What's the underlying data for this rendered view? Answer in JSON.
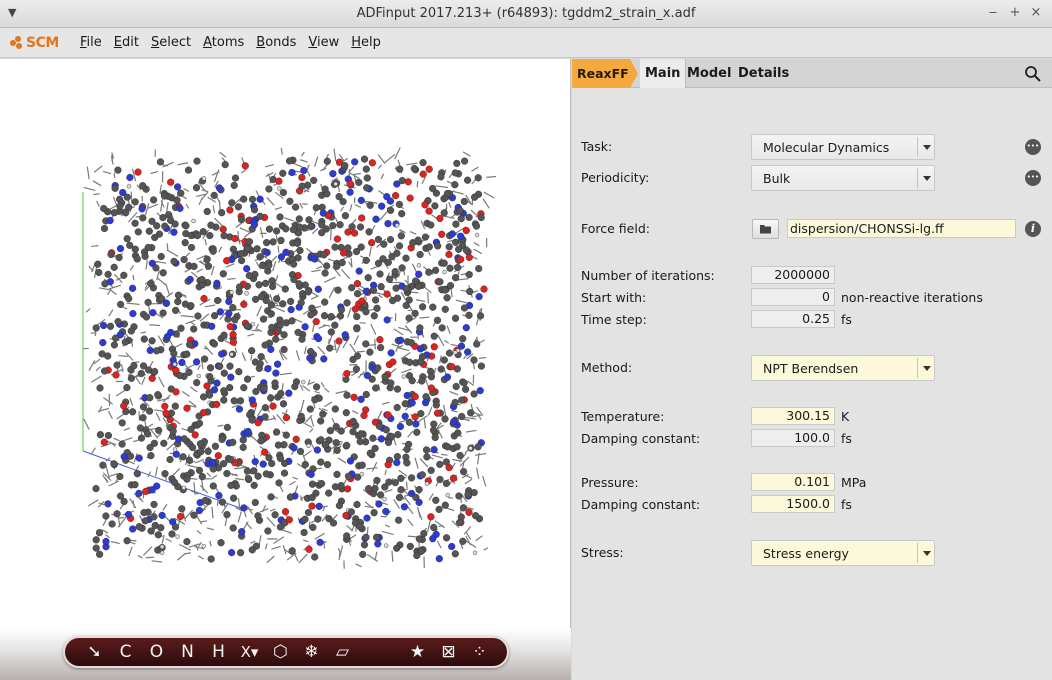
{
  "window": {
    "title": "ADFinput 2017.213+ (r64893): tgddm2_strain_x.adf",
    "menu_glyph": "▼",
    "min_glyph": "‒",
    "max_glyph": "+",
    "close_glyph": "×"
  },
  "logo": {
    "text": "SCM",
    "color": "#e2761a"
  },
  "menu": [
    "File",
    "Edit",
    "Select",
    "Atoms",
    "Bonds",
    "View",
    "Help"
  ],
  "toolbar": {
    "tools": [
      {
        "name": "select-arrow-tool",
        "glyph": "➘"
      },
      {
        "name": "carbon-tool",
        "glyph": "C"
      },
      {
        "name": "oxygen-tool",
        "glyph": "O"
      },
      {
        "name": "nitrogen-tool",
        "glyph": "N"
      },
      {
        "name": "hydrogen-tool",
        "glyph": "H"
      },
      {
        "name": "other-element-tool",
        "glyph": "X▾"
      },
      {
        "name": "ring-tool",
        "glyph": "⬡"
      },
      {
        "name": "structure-tool",
        "glyph": "❄"
      },
      {
        "name": "slab-tool",
        "glyph": "▱"
      },
      {
        "name": "favorites-tool",
        "glyph": "★"
      },
      {
        "name": "cell-tool",
        "glyph": "⊠"
      },
      {
        "name": "more-tools",
        "glyph": "⁘"
      }
    ]
  },
  "tabs": {
    "engine": "ReaxFF",
    "items": [
      {
        "label": "Main",
        "active": true
      },
      {
        "label": "Model",
        "active": false
      },
      {
        "label": "Details",
        "active": false
      }
    ]
  },
  "form": {
    "task": {
      "label": "Task:",
      "value": "Molecular Dynamics"
    },
    "periodicity": {
      "label": "Periodicity:",
      "value": "Bulk"
    },
    "force_field": {
      "label": "Force field:",
      "value": "dispersion/CHONSSi-lg.ff",
      "info": "i"
    },
    "iterations": {
      "label": "Number of iterations:",
      "value": "2000000"
    },
    "start_with": {
      "label": "Start with:",
      "value": "0",
      "unit": "non-reactive iterations"
    },
    "time_step": {
      "label": "Time step:",
      "value": "0.25",
      "unit": "fs"
    },
    "method": {
      "label": "Method:",
      "value": "NPT Berendsen"
    },
    "temperature": {
      "label": "Temperature:",
      "value": "300.15",
      "unit": "K"
    },
    "t_damping": {
      "label": "Damping constant:",
      "value": "100.0",
      "unit": "fs"
    },
    "pressure": {
      "label": "Pressure:",
      "value": "0.101",
      "unit": "MPa"
    },
    "p_damping": {
      "label": "Damping constant:",
      "value": "1500.0",
      "unit": "fs"
    },
    "stress": {
      "label": "Stress:",
      "value": "Stress energy"
    }
  },
  "colors": {
    "accent": "#f3a93b",
    "carbon": "#555555",
    "oxygen": "#e0221f",
    "nitrogen": "#2a3bd8",
    "hydrogen": "#dddddd"
  }
}
